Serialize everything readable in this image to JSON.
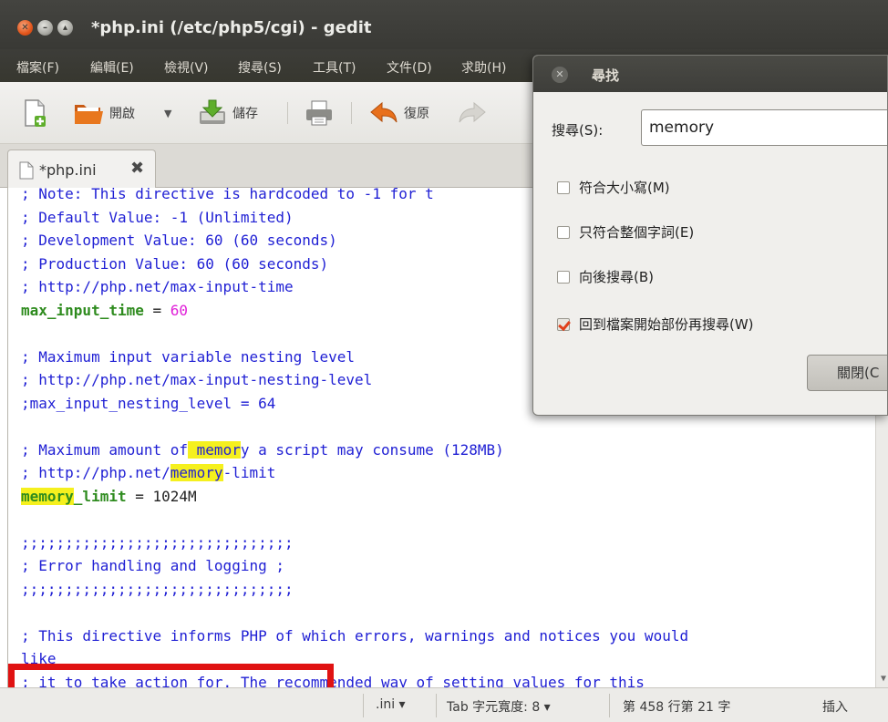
{
  "window": {
    "title": "*php.ini (/etc/php5/cgi) - gedit"
  },
  "menubar": {
    "items": [
      "檔案(F)",
      "編輯(E)",
      "檢視(V)",
      "搜尋(S)",
      "工具(T)",
      "文件(D)",
      "求助(H)"
    ]
  },
  "toolbar": {
    "open_label": "開啟",
    "save_label": "儲存",
    "undo_label": "復原"
  },
  "tab": {
    "label": "*php.ini"
  },
  "editor": {
    "lines": [
      "; Note: This directive is hardcoded to -1 for t",
      "; Default Value: -1 (Unlimited)",
      "; Development Value: 60 (60 seconds)",
      "; Production Value: 60 (60 seconds)",
      "; http://php.net/max-input-time",
      "max_input_time = 60",
      "",
      "; Maximum input variable nesting level",
      "; http://php.net/max-input-nesting-level",
      ";max_input_nesting_level = 64",
      "",
      "; Maximum amount of memory a script may consume (128MB)",
      "; http://php.net/memory-limit",
      "memory_limit = 1024M",
      "",
      ";;;;;;;;;;;;;;;;;;;;;;;;;;;;;;;",
      "; Error handling and logging ;",
      ";;;;;;;;;;;;;;;;;;;;;;;;;;;;;;;",
      "",
      "; This directive informs PHP of which errors, warnings and notices you would",
      "like",
      "; it to take action for. The recommended way of setting values for this"
    ]
  },
  "statusbar": {
    "language": ".ini ▾",
    "tab_width": "Tab 字元寬度: 8 ▾",
    "position": "第 458 行第 21 字",
    "mode": "插入"
  },
  "find_dialog": {
    "title": "尋找",
    "search_label": "搜尋(S):",
    "search_value": "memory",
    "options": [
      {
        "label": "符合大小寫(M)",
        "checked": false
      },
      {
        "label": "只符合整個字詞(E)",
        "checked": false
      },
      {
        "label": "向後搜尋(B)",
        "checked": false
      },
      {
        "label": "回到檔案開始部份再搜尋(W)",
        "checked": true
      }
    ],
    "close_label": "關閉(C"
  },
  "colors": {
    "comment": "#1f1fd4",
    "key": "#2e8b1e",
    "number": "#e020d8",
    "highlight": "#f5f01e",
    "annotation_box": "#e01212"
  }
}
